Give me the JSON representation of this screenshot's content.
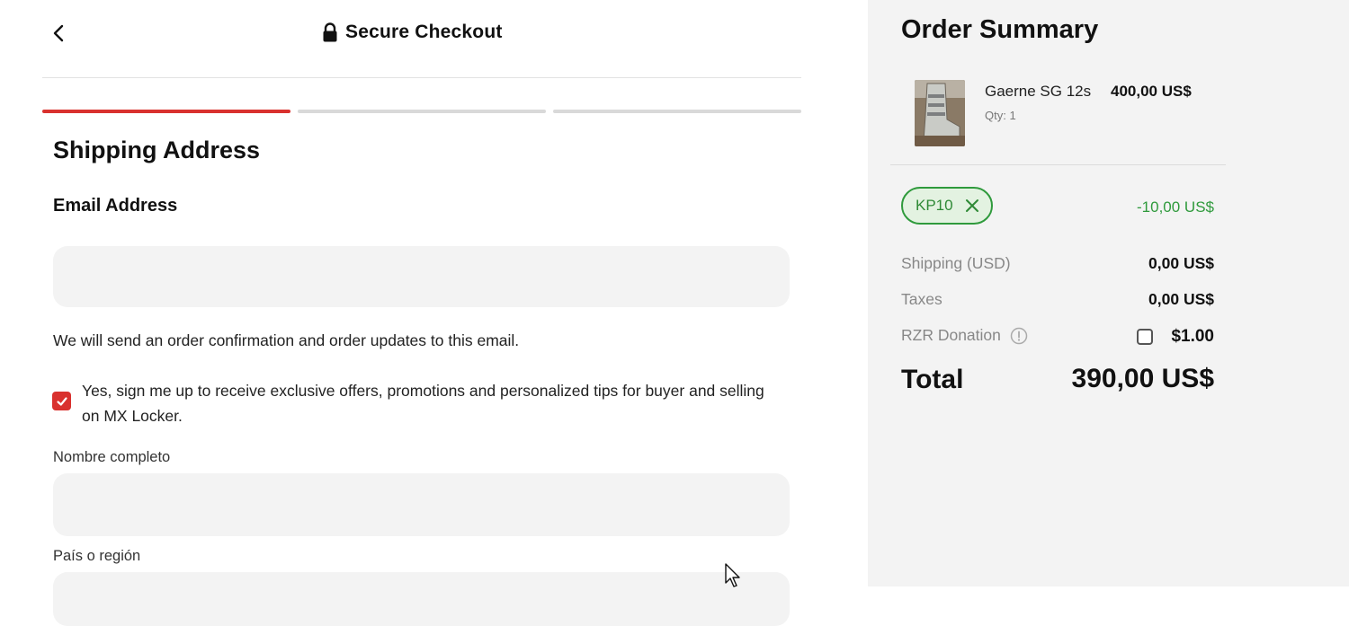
{
  "header": {
    "back_icon": "chevron-left-icon",
    "lock_icon": "lock-icon",
    "title": "Secure Checkout"
  },
  "progress": {
    "steps_total": 3,
    "current_step": 1,
    "accent_color": "#d9312e"
  },
  "form": {
    "section_title": "Shipping Address",
    "email": {
      "label": "Email Address",
      "value": "",
      "placeholder": ""
    },
    "email_help": "We will send an order confirmation and order updates to this email.",
    "marketing_opt_in": {
      "checked": true,
      "text": "Yes, sign me up to receive exclusive offers, promotions and personalized tips for buyer and selling on MX Locker."
    },
    "full_name": {
      "label": "Nombre completo",
      "value": ""
    },
    "country": {
      "label": "País o región",
      "value": ""
    }
  },
  "summary": {
    "title": "Order Summary",
    "item": {
      "name": "Gaerne SG 12s",
      "price": "400,00 US$",
      "qty": "Qty: 1"
    },
    "coupon": {
      "code": "KP10",
      "discount": "-10,00 US$",
      "color": "#2f9a3c"
    },
    "rows": {
      "shipping_label": "Shipping (USD)",
      "shipping_value": "0,00 US$",
      "taxes_label": "Taxes",
      "taxes_value": "0,00 US$",
      "donation_label": "RZR Donation",
      "donation_amount": "$1.00",
      "donation_checked": false
    },
    "total_label": "Total",
    "total_value": "390,00 US$"
  }
}
